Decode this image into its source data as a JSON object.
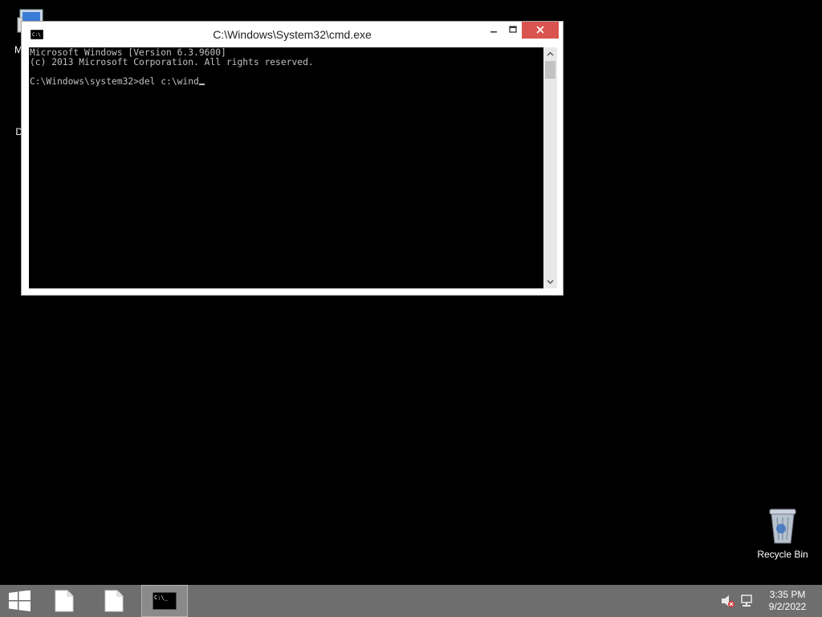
{
  "desktop": {
    "icons": [
      {
        "label": "My C"
      },
      {
        "label": "Data"
      },
      {
        "label": "Recycle Bin"
      }
    ]
  },
  "window": {
    "title": "C:\\Windows\\System32\\cmd.exe",
    "minimize_glyph": "🗕",
    "maximize_glyph": "☐",
    "close_glyph": "✕",
    "console_lines": [
      "Microsoft Windows [Version 6.3.9600]",
      "(c) 2013 Microsoft Corporation. All rights reserved.",
      "",
      "C:\\Windows\\system32>del c:\\wind"
    ]
  },
  "taskbar": {
    "clock_time": "3:35 PM",
    "clock_date": "9/2/2022"
  },
  "colors": {
    "desktop_bg": "#000000",
    "taskbar_bg": "#6e6e6e",
    "close_button": "#d9534f"
  },
  "icons": [
    "computer-icon",
    "data-icon",
    "recycle-bin-icon",
    "cmd-icon",
    "windows-logo-icon",
    "file-icon",
    "volume-muted-icon",
    "network-icon"
  ]
}
